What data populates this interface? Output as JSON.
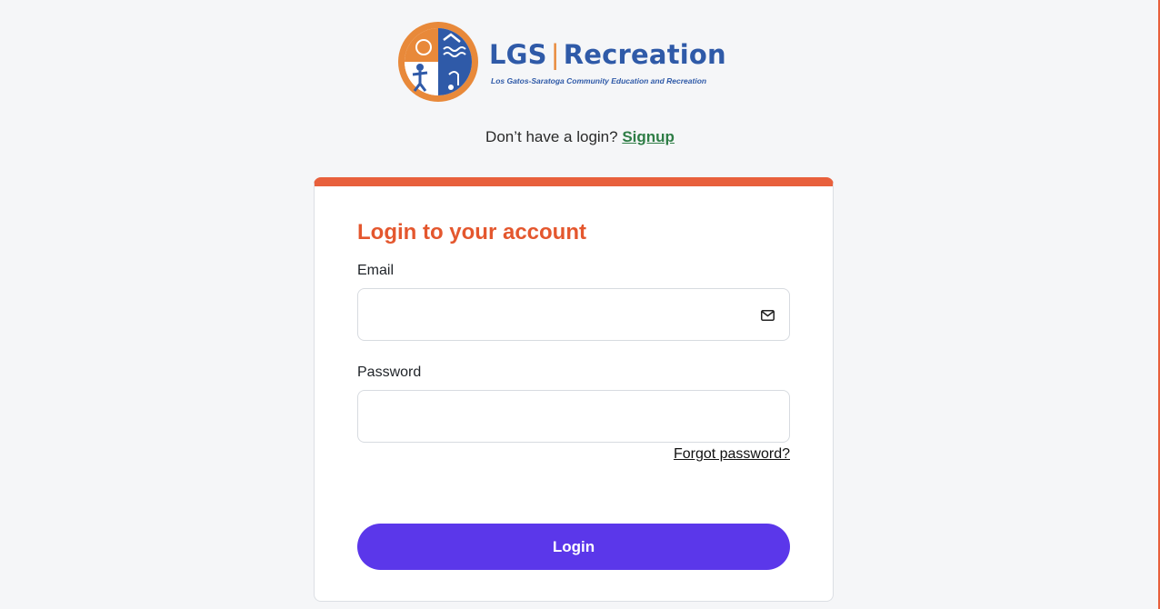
{
  "brand": {
    "name_left": "LGS",
    "name_right": "Recreation",
    "tagline": "Los Gatos-Saratoga Community Education and Recreation",
    "colors": {
      "orange": "#e8893a",
      "blue": "#2f5aa8"
    },
    "logo_icon": "lgs-recreation-logo-mark"
  },
  "signup": {
    "prompt": "Don’t have a login?",
    "link_label": "Signup"
  },
  "login_card": {
    "title": "Login to your account",
    "email_label": "Email",
    "email_value": "",
    "email_icon": "mail-icon",
    "password_label": "Password",
    "password_value": "",
    "forgot_label": "Forgot password?",
    "submit_label": "Login",
    "accent_color": "#e8603c",
    "button_color": "#5b37ea"
  }
}
